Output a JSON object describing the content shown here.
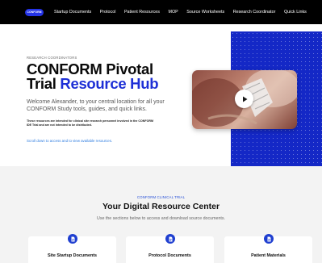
{
  "nav": {
    "logo_text": "CONFORM",
    "items": [
      {
        "label": "Startup Documents"
      },
      {
        "label": "Protocol"
      },
      {
        "label": "Patient Resources"
      },
      {
        "label": "MOP"
      },
      {
        "label": "Source Worksheets"
      },
      {
        "label": "Research Coordinator"
      },
      {
        "label": "Quick Links"
      }
    ]
  },
  "hero": {
    "eyebrow": "RESEARCH COORDINATORS",
    "title_line1": "CONFORM Pivotal",
    "title_line2_plain": "Trial ",
    "title_line2_accent": "Resource Hub",
    "welcome": "Welcome Alexander, to your central location for all your CONFORM Study tools, guides, and quick links.",
    "disclaimer": "These resources are intended for clinical site research personnel involved in the CONFORM IDE Trial and are not intended to be distributed.",
    "scroll_link": "Scroll down to access and to view available resources.",
    "video_icon": "play-icon"
  },
  "resource_center": {
    "eyebrow": "CONFORM CLINICAL TRIAL",
    "title": "Your Digital Resource Center",
    "subtitle": "Use the sections below to access and download source documents.",
    "cards": [
      {
        "label": "Site Startup Documents",
        "icon": "document-icon"
      },
      {
        "label": "Protocol Documents",
        "icon": "document-icon"
      },
      {
        "label": "Patient Materials",
        "icon": "document-icon"
      }
    ]
  },
  "colors": {
    "nav_bg": "#000000",
    "brand_blue": "#1d2fd6",
    "panel_blue": "#1428c6",
    "link_blue": "#2f7de0",
    "section_bg": "#f3f3f3"
  }
}
